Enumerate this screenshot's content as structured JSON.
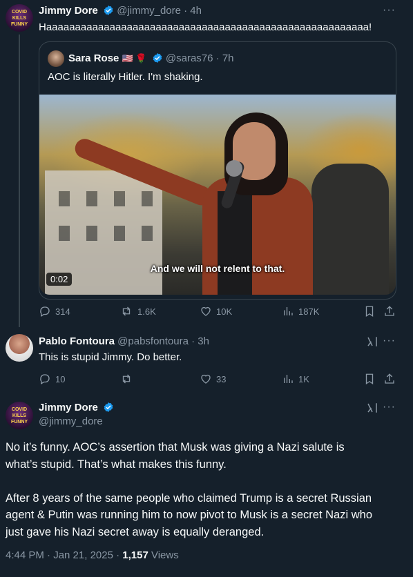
{
  "tweet1": {
    "display_name": "Jimmy Dore",
    "handle": "@jimmy_dore",
    "time": "· 4h",
    "text": "Haaaaaaaaaaaaaaaaaaaaaaaaaaaaaaaaaaaaaaaaaaaaaaaaaaaaaaaa!",
    "avatar_text": [
      "COVID",
      "KILLS",
      "FUNNY"
    ],
    "quote": {
      "display_name": "Sara Rose",
      "flags": "🇺🇸 🌹",
      "handle": "@saras76",
      "time": "· 7h",
      "text": "AOC is literally Hitler. I'm shaking.",
      "video_subtitle": "And we will not relent to that.",
      "video_time": "0:02"
    },
    "stats": {
      "replies": "314",
      "reposts": "1.6K",
      "likes": "10K",
      "views": "187K"
    }
  },
  "reply": {
    "display_name": "Pablo Fontoura",
    "handle": "@pabsfontoura",
    "time": "· 3h",
    "text": "This is stupid Jimmy. Do better.",
    "stats": {
      "replies": "10",
      "reposts": "",
      "likes": "33",
      "views": "1K"
    }
  },
  "main": {
    "display_name": "Jimmy Dore",
    "handle": "@jimmy_dore",
    "para1_lines": [
      "No it’s funny. AOC’s assertion that Musk was giving a Nazi salute is",
      "what’s stupid. That’s what makes this funny."
    ],
    "para2_lines": [
      "After 8 years of  the same people who claimed Trump is a secret Russian",
      "agent & Putin was running him to now pivot to Musk is a secret Nazi who",
      "just gave his Nazi secret away is equally deranged."
    ],
    "timestamp": "4:44 PM · Jan 21, 2025 · ",
    "views_count": "1,157",
    "views_label": " Views"
  },
  "colors": {
    "background": "#15202b",
    "text": "#f7f9f9",
    "muted": "#8b98a5",
    "verified": "#1d9bf0",
    "border": "#38444d"
  }
}
